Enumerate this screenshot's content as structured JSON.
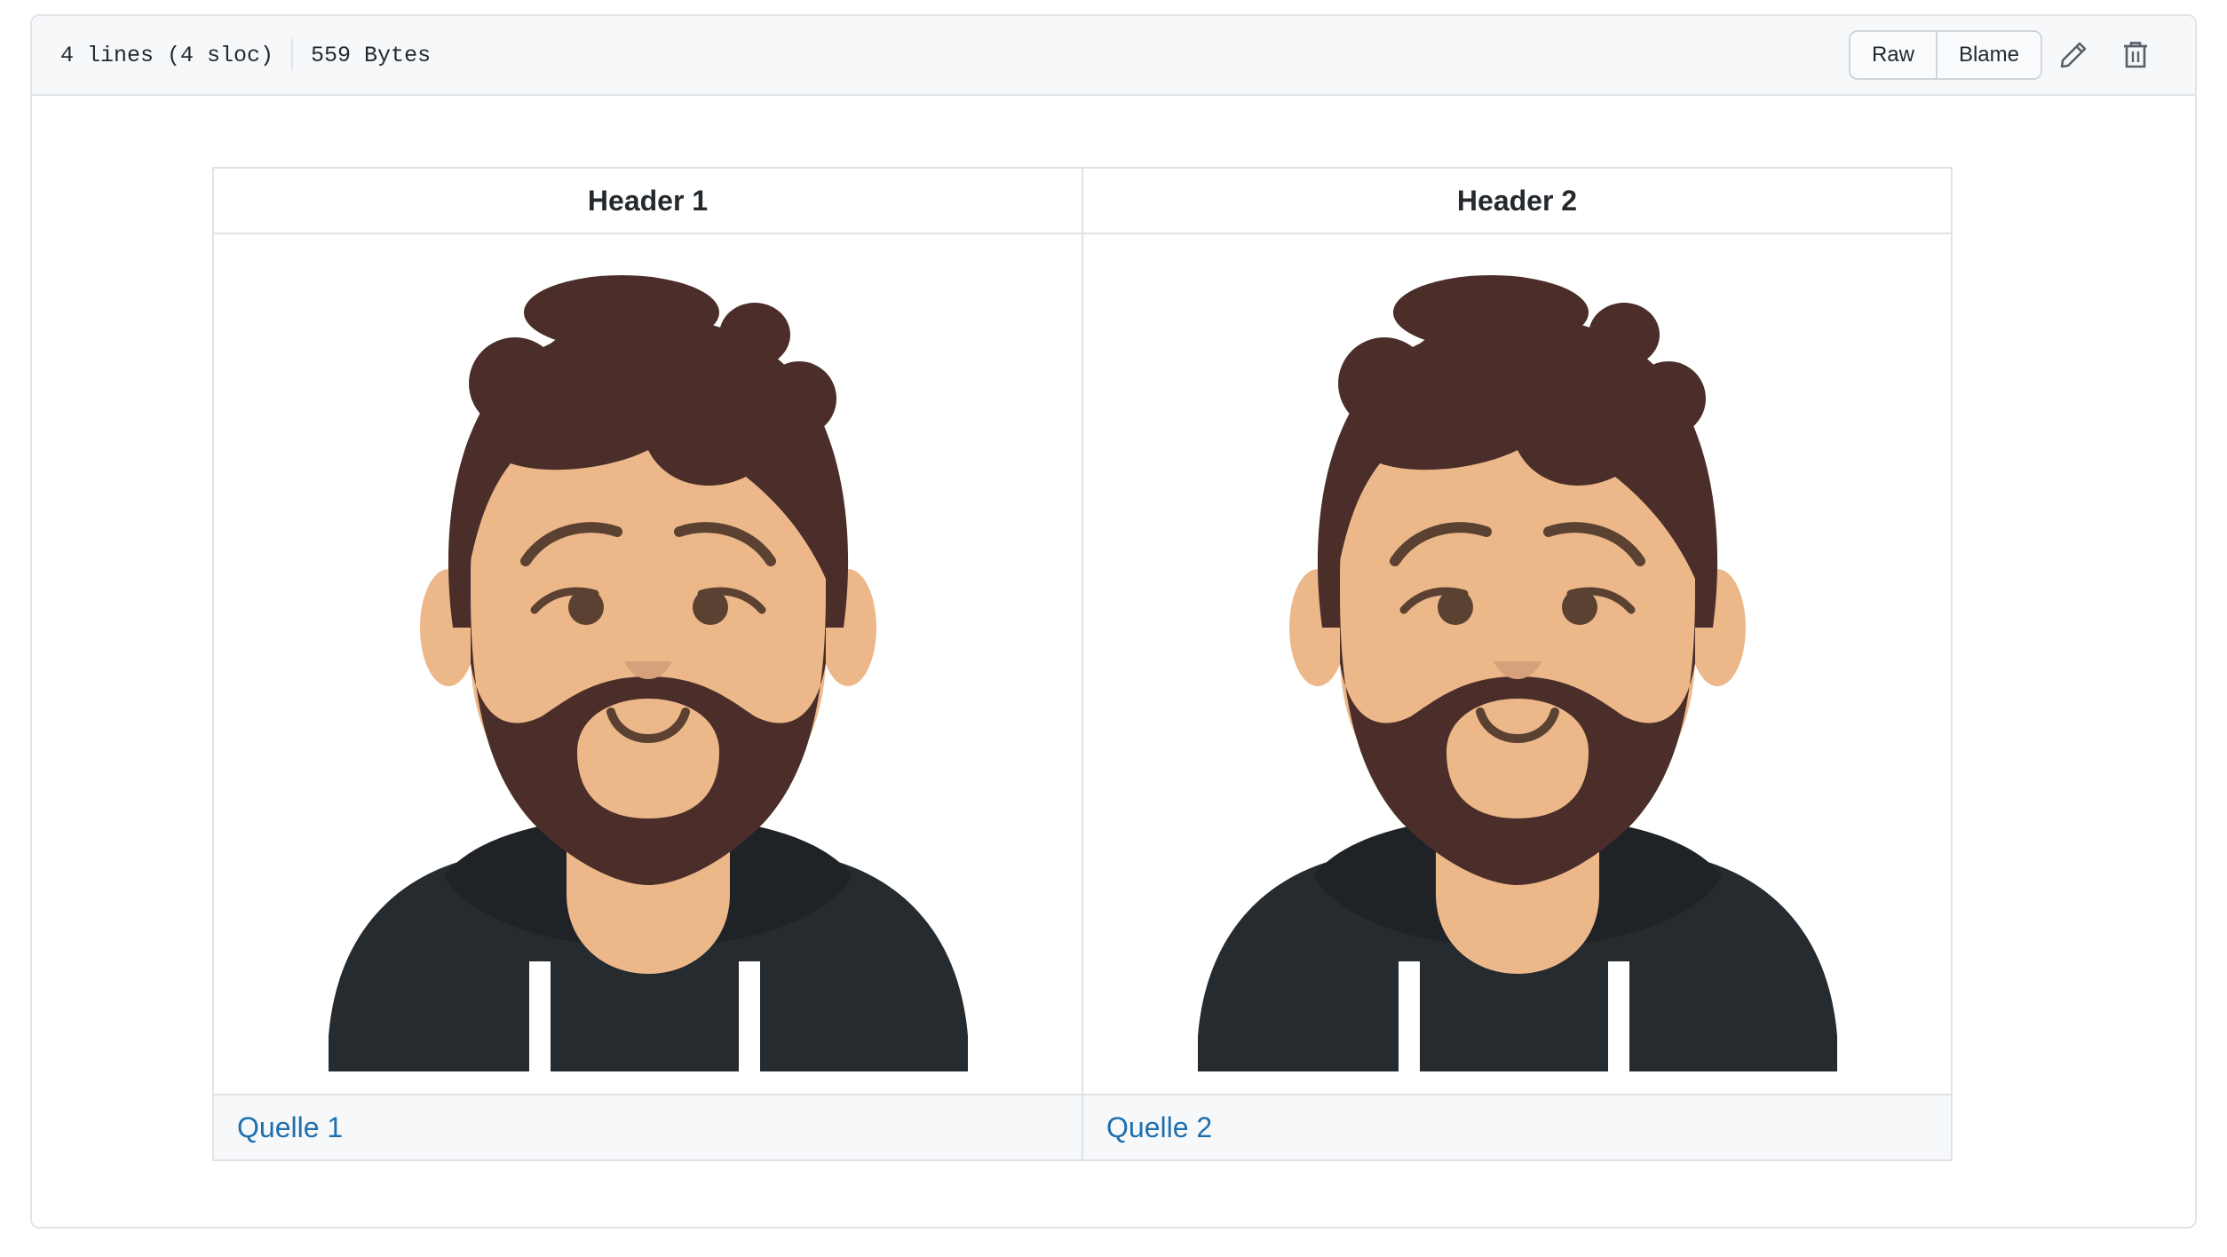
{
  "file_header": {
    "lines": "4 lines (4 sloc)",
    "size": "559 Bytes",
    "raw_label": "Raw",
    "blame_label": "Blame",
    "edit_icon": "pencil-icon",
    "delete_icon": "trash-icon"
  },
  "table": {
    "headers": [
      "Header 1",
      "Header 2"
    ],
    "images": [
      "avatar-bearded-man",
      "avatar-bearded-man"
    ],
    "links": [
      "Quelle 1",
      "Quelle 2"
    ]
  },
  "colors": {
    "hair": "#4b2e2a",
    "skin": "#ecb88a",
    "hoodie": "#262b30",
    "link": "#1f6fad"
  }
}
